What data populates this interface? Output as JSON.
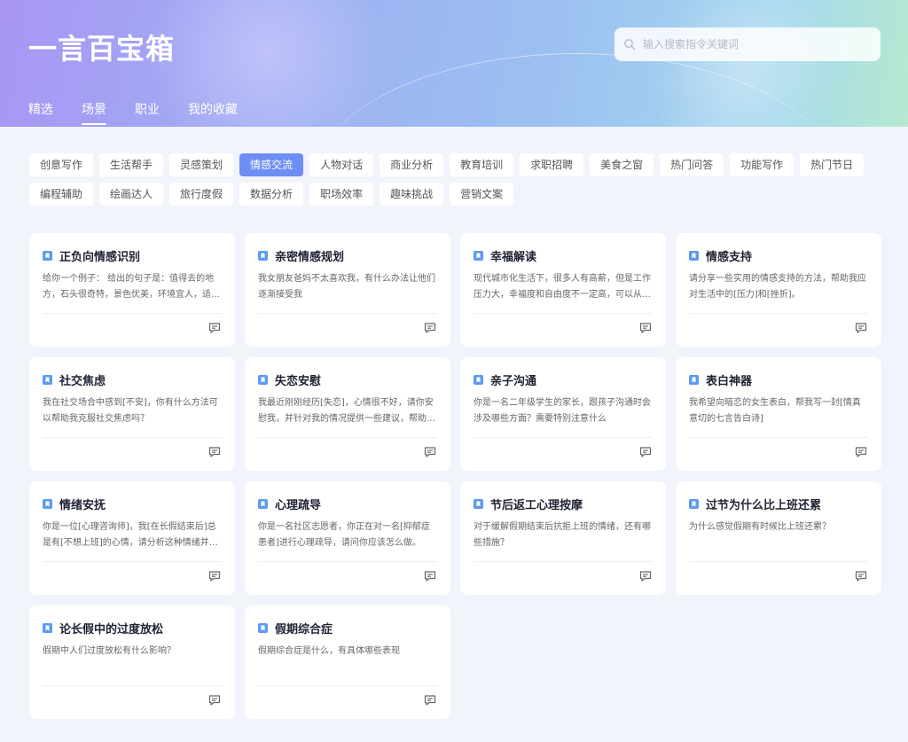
{
  "app": {
    "title": "一言百宝箱"
  },
  "search": {
    "placeholder": "输入搜索指令关键词"
  },
  "tabs": [
    {
      "label": "精选",
      "active": false
    },
    {
      "label": "场景",
      "active": true
    },
    {
      "label": "职业",
      "active": false
    },
    {
      "label": "我的收藏",
      "active": false
    }
  ],
  "categories": [
    {
      "label": "创意写作",
      "active": false
    },
    {
      "label": "生活帮手",
      "active": false
    },
    {
      "label": "灵感策划",
      "active": false
    },
    {
      "label": "情感交流",
      "active": true
    },
    {
      "label": "人物对话",
      "active": false
    },
    {
      "label": "商业分析",
      "active": false
    },
    {
      "label": "教育培训",
      "active": false
    },
    {
      "label": "求职招聘",
      "active": false
    },
    {
      "label": "美食之窗",
      "active": false
    },
    {
      "label": "热门问答",
      "active": false
    },
    {
      "label": "功能写作",
      "active": false
    },
    {
      "label": "热门节日",
      "active": false
    },
    {
      "label": "编程辅助",
      "active": false
    },
    {
      "label": "绘画达人",
      "active": false
    },
    {
      "label": "旅行度假",
      "active": false
    },
    {
      "label": "数据分析",
      "active": false
    },
    {
      "label": "职场效率",
      "active": false
    },
    {
      "label": "趣味挑战",
      "active": false
    },
    {
      "label": "营销文案",
      "active": false
    }
  ],
  "cards": [
    {
      "title": "正负向情感识别",
      "desc": "给你一个例子： 给出的句子是：值得去的地方，石头很奇特，景色优美，环境宜人，适合带孩子游玩"
    },
    {
      "title": "亲密情感规划",
      "desc": "我女朋友爸妈不太喜欢我，有什么办法让他们逐渐接受我"
    },
    {
      "title": "幸福解读",
      "desc": "现代城市化生活下，很多人有高薪，但是工作压力大，幸福度和自由度不一定高，可以从哪些方面解读幸福"
    },
    {
      "title": "情感支持",
      "desc": "请分享一些实用的情感支持的方法，帮助我应对生活中的[压力]和[挫折]。"
    },
    {
      "title": "社交焦虑",
      "desc": "我在社交场合中感到[不安]，你有什么方法可以帮助我克服社交焦虑吗？"
    },
    {
      "title": "失恋安慰",
      "desc": "我最近刚刚经历[失恋]，心情很不好，请你安慰我，并针对我的情况提供一些建议，帮助我走出来"
    },
    {
      "title": "亲子沟通",
      "desc": "你是一名二年级学生的家长，跟孩子沟通时会涉及哪些方面？需要特别注意什么"
    },
    {
      "title": "表白神器",
      "desc": "我希望向暗恋的女生表白，帮我写一封[情真意切的七言告白诗]"
    },
    {
      "title": "情绪安抚",
      "desc": "你是一位[心理咨询师]，我[在长假结束后]总是有[不想上班]的心情，请分析这种情绪并给出建议"
    },
    {
      "title": "心理疏导",
      "desc": "你是一名社区志愿者，你正在对一名[抑郁症患者]进行心理疏导，请问你应该怎么做。"
    },
    {
      "title": "节后返工心理按摩",
      "desc": "对于缓解假期结束后抗拒上班的情绪，还有哪些措施？"
    },
    {
      "title": "过节为什么比上班还累",
      "desc": "为什么感觉假期有时候比上班还累？"
    },
    {
      "title": "论长假中的过度放松",
      "desc": "假期中人们过度放松有什么影响？"
    },
    {
      "title": "假期综合症",
      "desc": "假期综合症是什么，有具体哪些表现"
    }
  ],
  "colors": {
    "accent": "#6e8ef3",
    "card_icon": "#5b9bf0"
  },
  "icons": {
    "search": "search-icon",
    "card": "bookmark-icon",
    "chat": "chat-icon"
  }
}
